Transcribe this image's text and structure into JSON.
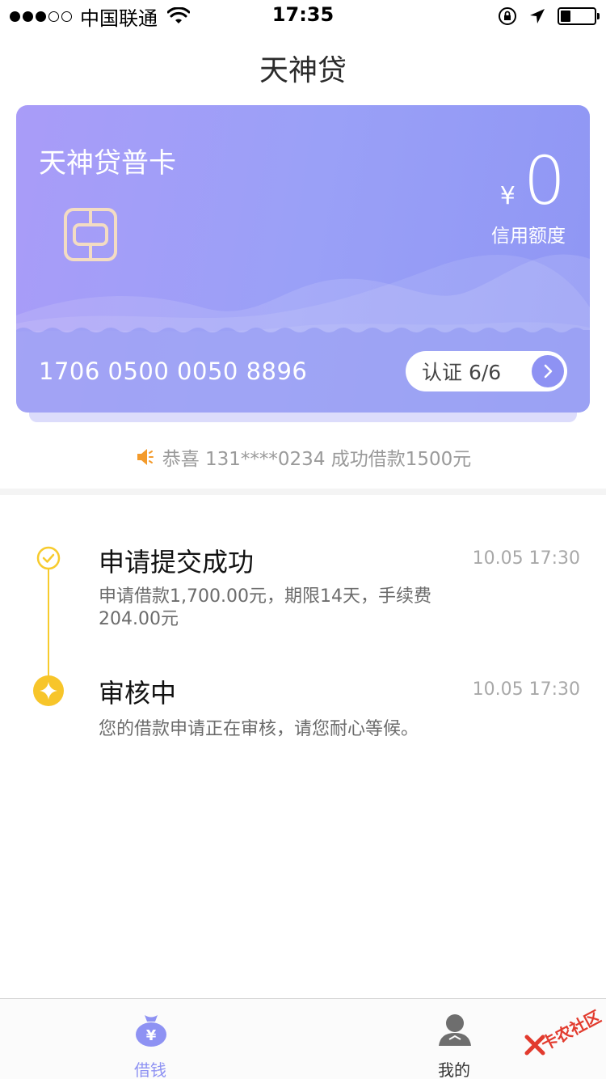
{
  "status_bar": {
    "carrier": "中国联通",
    "time": "17:35",
    "battery_level": 0.3
  },
  "header": {
    "title": "天神贷"
  },
  "card": {
    "name": "天神贷普卡",
    "currency": "¥",
    "amount": "0",
    "amount_label": "信用额度",
    "number": "1706 0500 0050 8896",
    "verify_label": "认证 6/6"
  },
  "notice": {
    "text": "恭喜 131****0234 成功借款1500元"
  },
  "timeline": [
    {
      "title": "申请提交成功",
      "time": "10.05 17:30",
      "description": "申请借款1,700.00元，期限14天，手续费204.00元",
      "status": "done"
    },
    {
      "title": "审核中",
      "time": "10.05 17:30",
      "description": "您的借款申请正在审核，请您耐心等候。",
      "status": "current"
    }
  ],
  "tabbar": {
    "tabs": [
      {
        "label": "借钱",
        "icon": "money-bag-icon",
        "active": true
      },
      {
        "label": "我的",
        "icon": "user-icon",
        "active": false
      }
    ]
  },
  "watermark": {
    "text": "卡农社区"
  },
  "colors": {
    "accent": "#8e92f3",
    "timeline": "#f7cb2d",
    "tab_active": "#8e92f3",
    "tab_inactive": "#555555",
    "notice_icon": "#f39a2b"
  }
}
